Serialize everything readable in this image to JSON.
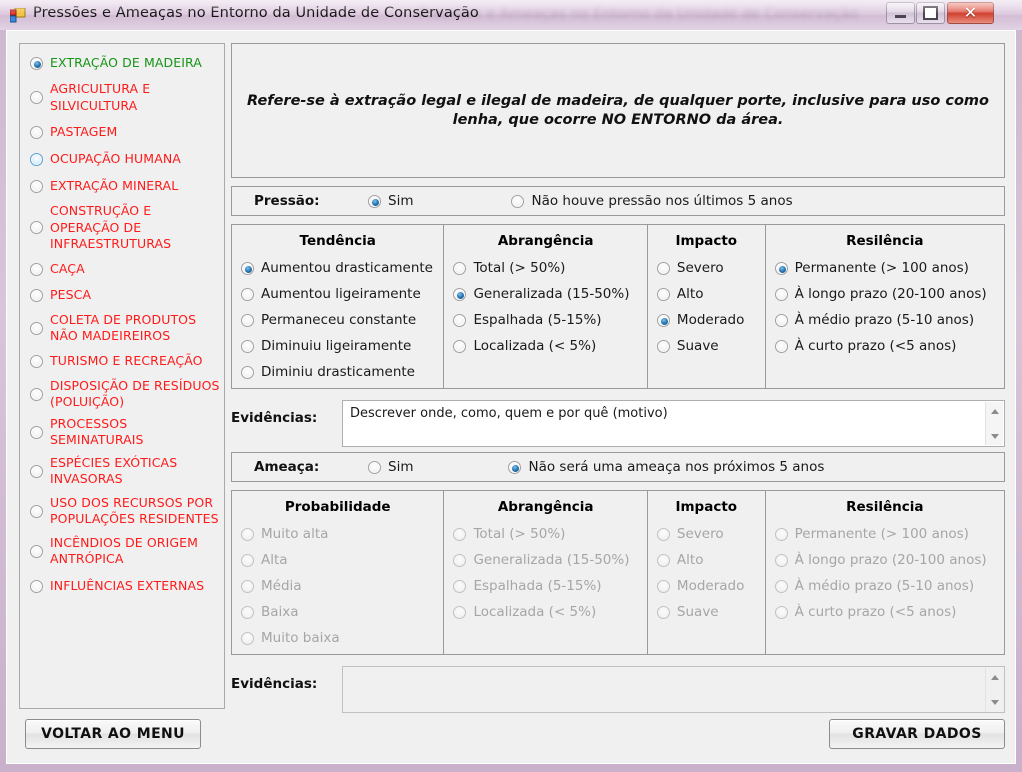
{
  "window": {
    "title": "Pressões e Ameaças no Entorno da Unidade de Conservação",
    "icon": "form-icon",
    "minimize_label": "Minimizar",
    "maximize_label": "Maximizar",
    "close_label": "Fechar"
  },
  "sidebar": {
    "items": [
      {
        "label": "EXTRAÇÃO DE MADEIRA",
        "state": "selected",
        "color": "#169416"
      },
      {
        "label": "AGRICULTURA E SILVICULTURA",
        "state": "normal",
        "color": "#ff1a1a"
      },
      {
        "label": "PASTAGEM",
        "state": "normal",
        "color": "#ff1a1a"
      },
      {
        "label": "OCUPAÇÃO HUMANA",
        "state": "hover",
        "color": "#ff1a1a"
      },
      {
        "label": "EXTRAÇÃO MINERAL",
        "state": "normal",
        "color": "#ff1a1a"
      },
      {
        "label": "CONSTRUÇÃO E OPERAÇÃO DE INFRAESTRUTURAS",
        "state": "normal",
        "color": "#ff1a1a"
      },
      {
        "label": "CAÇA",
        "state": "normal",
        "color": "#ff1a1a"
      },
      {
        "label": "PESCA",
        "state": "normal",
        "color": "#ff1a1a"
      },
      {
        "label": "COLETA DE PRODUTOS NÃO MADEIREIROS",
        "state": "normal",
        "color": "#ff1a1a"
      },
      {
        "label": "TURISMO E RECREAÇÃO",
        "state": "normal",
        "color": "#ff1a1a"
      },
      {
        "label": "DISPOSIÇÃO DE RESÍDUOS (POLUIÇÃO)",
        "state": "normal",
        "color": "#ff1a1a"
      },
      {
        "label": "PROCESSOS SEMINATURAIS",
        "state": "normal",
        "color": "#ff1a1a"
      },
      {
        "label": "ESPÉCIES EXÓTICAS INVASORAS",
        "state": "normal",
        "color": "#ff1a1a"
      },
      {
        "label": "USO DOS RECURSOS POR POPULAÇÕES RESIDENTES",
        "state": "normal",
        "color": "#ff1a1a"
      },
      {
        "label": "INCÊNDIOS DE ORIGEM ANTRÓPICA",
        "state": "normal",
        "color": "#ff1a1a"
      },
      {
        "label": "INFLUÊNCIAS EXTERNAS",
        "state": "normal",
        "color": "#ff1a1a"
      }
    ]
  },
  "description": {
    "text": "Refere-se à extração legal e ilegal de madeira, de qualquer porte, inclusive para uso como lenha, que ocorre NO ENTORNO da área."
  },
  "pressao": {
    "label": "Pressão:",
    "option_yes": "Sim",
    "option_no": "Não houve pressão nos últimos 5 anos",
    "selected": "Sim",
    "columns": {
      "tendencia": {
        "header": "Tendência",
        "options": [
          "Aumentou drasticamente",
          "Aumentou ligeiramente",
          "Permaneceu constante",
          "Diminuiu ligeiramente",
          "Diminiu drasticamente"
        ],
        "selected_index": 0
      },
      "abrangencia": {
        "header": "Abrangência",
        "options": [
          "Total (> 50%)",
          "Generalizada (15-50%)",
          "Espalhada (5-15%)",
          "Localizada (< 5%)"
        ],
        "selected_index": 1
      },
      "impacto": {
        "header": "Impacto",
        "options": [
          "Severo",
          "Alto",
          "Moderado",
          "Suave"
        ],
        "selected_index": 2
      },
      "resiliencia": {
        "header": "Resilência",
        "options": [
          "Permanente (> 100 anos)",
          "À longo prazo (20-100 anos)",
          "À médio prazo (5-10 anos)",
          "À curto prazo (<5 anos)"
        ],
        "selected_index": 0
      }
    },
    "evidencias_label": "Evidências:",
    "evidencias_value": "Descrever onde, como, quem e por quê (motivo)"
  },
  "ameaca": {
    "label": "Ameaça:",
    "option_yes": "Sim",
    "option_no": "Não será uma ameaça nos próximos 5 anos",
    "selected": "Não será uma ameaça nos próximos 5 anos",
    "disabled": true,
    "columns": {
      "probabilidade": {
        "header": "Probabilidade",
        "options": [
          "Muito alta",
          "Alta",
          "Média",
          "Baixa",
          "Muito baixa"
        ],
        "selected_index": -1
      },
      "abrangencia": {
        "header": "Abrangência",
        "options": [
          "Total (> 50%)",
          "Generalizada (15-50%)",
          "Espalhada (5-15%)",
          "Localizada (< 5%)"
        ],
        "selected_index": -1
      },
      "impacto": {
        "header": "Impacto",
        "options": [
          "Severo",
          "Alto",
          "Moderado",
          "Suave"
        ],
        "selected_index": -1
      },
      "resiliencia": {
        "header": "Resilência",
        "options": [
          "Permanente (> 100 anos)",
          "À longo prazo (20-100 anos)",
          "À médio prazo (5-10 anos)",
          "À curto prazo (<5 anos)"
        ],
        "selected_index": -1
      }
    },
    "evidencias_label": "Evidências:",
    "evidencias_value": ""
  },
  "footer": {
    "back_label": "VOLTAR AO MENU",
    "save_label": "GRAVAR DADOS"
  },
  "colors": {
    "sidebar_active": "#169416",
    "sidebar_inactive": "#ff1a1a",
    "radio_selected": "#2a79b4",
    "titlebar": "#ddc9de",
    "close_button": "#cf3d2c"
  }
}
